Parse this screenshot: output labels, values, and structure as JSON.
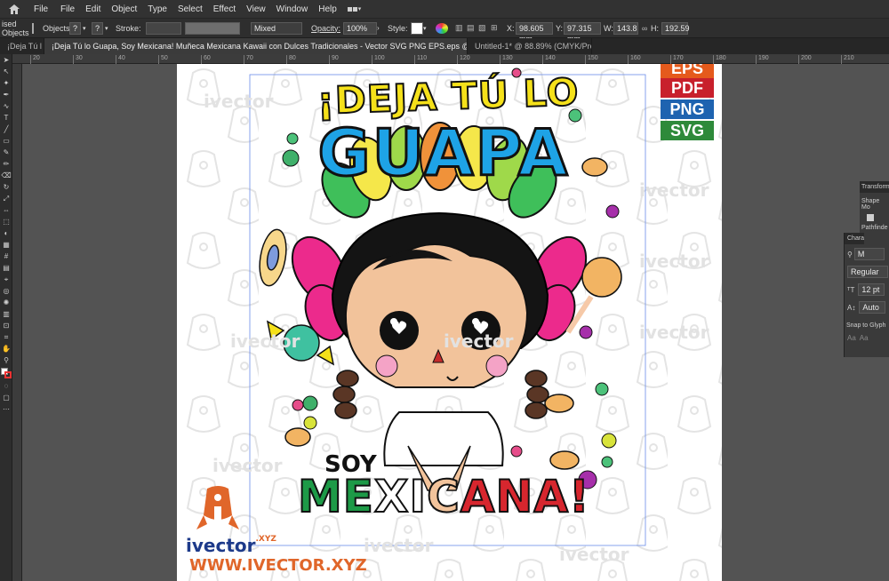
{
  "menubar": {
    "app_label": "File",
    "items": [
      "File",
      "Edit",
      "Object",
      "Type",
      "Select",
      "Effect",
      "View",
      "Window",
      "Help"
    ]
  },
  "controlbar": {
    "left_label": "ised Objects",
    "objects_label": "Objects",
    "q1": "?",
    "q2": "?",
    "stroke_label": "Stroke:",
    "mixed_value": "Mixed",
    "opacity_label": "Opacity:",
    "opacity_value": "100%",
    "style_label": "Style:",
    "x_label": "X:",
    "x_value": "98.605 mm",
    "y_label": "Y:",
    "y_value": "97.315 mm",
    "w_label": "W:",
    "w_value": "143.8",
    "h_label": "H:",
    "h_value": "192.59"
  },
  "tabs": [
    {
      "label": "¡Deja Tú l"
    },
    {
      "label": "¡Deja Tú lo Guapa, Soy Mexicana! Muñeca Mexicana Kawaii con Dulces Tradicionales - Vector SVG PNG EPS.eps @ 150% (CMYK/Preview)"
    },
    {
      "label": "Untitled-1* @ 88.89% (CMYK/Preview)"
    }
  ],
  "ruler": {
    "ticks": [
      "20",
      "30",
      "40",
      "50",
      "60",
      "70",
      "80",
      "90",
      "100",
      "110",
      "120",
      "130",
      "140",
      "150",
      "160",
      "170",
      "180",
      "190",
      "200",
      "210"
    ]
  },
  "artwork": {
    "headline1": "¡DEJA TÚ LO",
    "headline2": "GUAPA",
    "subline": "SOY",
    "mexicana_m": "ME",
    "mexicana_x": "X",
    "mexicana_i": "I",
    "mexicana_c": "C",
    "mexicana_ana": "ANA!",
    "watermark": "ivector",
    "brand": "ivector",
    "brand_suffix": ".XYZ",
    "website": "WWW.IVECTOR.XYZ",
    "formats": [
      "EPS",
      "PDF",
      "PNG",
      "SVG"
    ],
    "format_colors": [
      "#e55a1c",
      "#c8202c",
      "#1e63b0",
      "#2e8a3a"
    ]
  },
  "panels": {
    "transform_label": "Transform",
    "shape_label": "Shape Mo",
    "pathfinder_label": "Pathfinde",
    "char_label": "Chara",
    "font_style": "Regular",
    "font_size": "12 pt",
    "leading": "Auto",
    "snap_label": "Snap to Glyph"
  },
  "colors": {
    "yellow": "#f5e11a",
    "blue": "#1ea3e6",
    "green": "#1d9a47",
    "red": "#d7262e",
    "skin": "#f2c39b"
  }
}
